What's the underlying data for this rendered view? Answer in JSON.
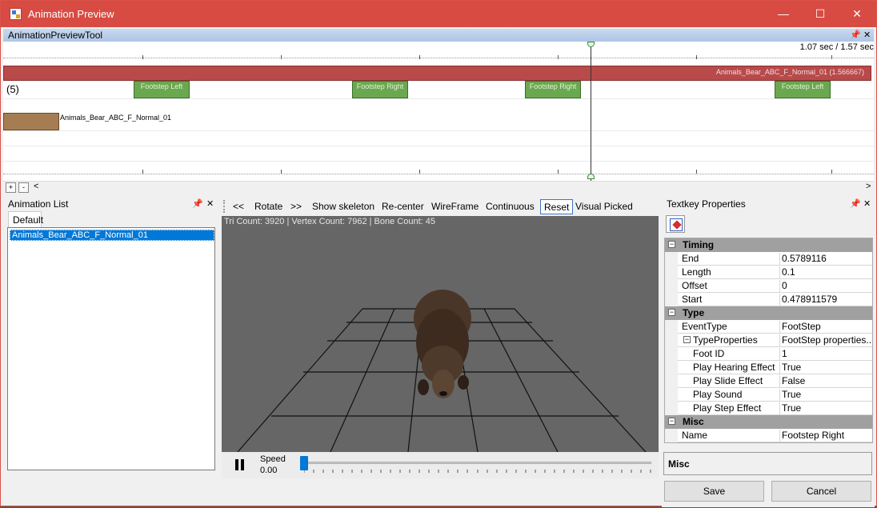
{
  "window": {
    "title": "Animation Preview",
    "controls": {
      "minimize": "—",
      "maximize": "☐",
      "close": "✕"
    }
  },
  "tool": {
    "title": "AnimationPreviewTool",
    "pin": "📌",
    "close": "✕"
  },
  "timeline": {
    "time_readout": "1.07 sec / 1.57 sec",
    "clip_bar_label": "Animals_Bear_ABC_F_Normal_01  (1.566667)",
    "event_count": "(5)",
    "keys": [
      "Footstep Left",
      "Footstep Right",
      "Footstep Right",
      "Footstep Left"
    ],
    "clip_name": "Animals_Bear_ABC_F_Normal_01"
  },
  "scroll": {
    "left": "<",
    "right": ">",
    "btn1": "+",
    "btn2": "-"
  },
  "anim_list": {
    "title": "Animation List",
    "tab": "Default",
    "items": [
      "Animals_Bear_ABC_F_Normal_01"
    ]
  },
  "viewer": {
    "toolbar": [
      "<<",
      "Rotate",
      ">>",
      "Show skeleton",
      "Re-center",
      "WireFrame",
      "Continuous",
      "Reset",
      "Visual Picked"
    ],
    "stats": "Tri Count: 3920  |  Vertex Count: 7962  |  Bone Count: 45",
    "speed_label": "Speed",
    "speed_value": "0.00",
    "speed_fraction": 0.0
  },
  "props": {
    "title": "Textkey Properties",
    "rows": [
      {
        "type": "cat",
        "name": "Timing"
      },
      {
        "type": "prop",
        "name": "End",
        "value": "0.5789116"
      },
      {
        "type": "prop",
        "name": "Length",
        "value": "0.1"
      },
      {
        "type": "prop",
        "name": "Offset",
        "value": "0"
      },
      {
        "type": "prop",
        "name": "Start",
        "value": "0.478911579"
      },
      {
        "type": "cat",
        "name": "Type"
      },
      {
        "type": "prop",
        "name": "EventType",
        "value": "FootStep"
      },
      {
        "type": "sub",
        "name": "TypeProperties",
        "value": "FootStep properties..."
      },
      {
        "type": "prop2",
        "name": "Foot ID",
        "value": "1"
      },
      {
        "type": "prop2",
        "name": "Play Hearing Effect",
        "value": "True"
      },
      {
        "type": "prop2",
        "name": "Play Slide Effect",
        "value": "False"
      },
      {
        "type": "prop2",
        "name": "Play Sound",
        "value": "True"
      },
      {
        "type": "prop2",
        "name": "Play Step Effect",
        "value": "True"
      },
      {
        "type": "cat",
        "name": "Misc"
      },
      {
        "type": "prop",
        "name": "Name",
        "value": "Footstep Right"
      }
    ],
    "description_title": "Misc",
    "save": "Save",
    "cancel": "Cancel"
  }
}
